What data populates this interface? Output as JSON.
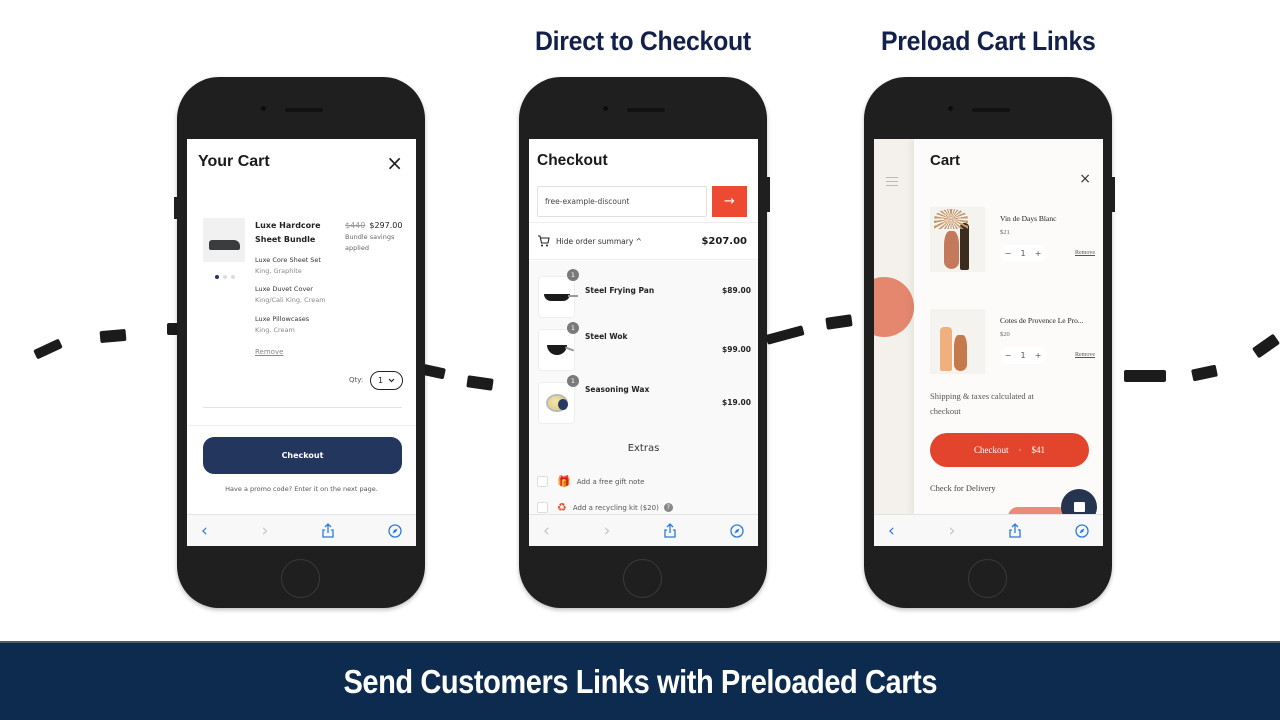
{
  "headings": {
    "direct_to_checkout": "Direct to Checkout",
    "preload_cart_links": "Preload Cart Links"
  },
  "banner": {
    "text": "Send Customers Links with  Preloaded Carts"
  },
  "colors": {
    "navy": "#13214a",
    "banner_bg": "#0d2a4f",
    "checkout_navy": "#23365d",
    "accent_red": "#ee4a31",
    "ios_blue": "#2a7ae2"
  },
  "phone1": {
    "title": "Your Cart",
    "close_icon": "×",
    "product": {
      "name": "Luxe Hardcore Sheet Bundle",
      "original_price": "$440",
      "price": "$297.00",
      "savings_note": "Bundle savings applied",
      "image_carousel": {
        "count": 3,
        "active": 1
      },
      "components": [
        {
          "name": "Luxe Core Sheet Set",
          "variant": "King, Graphite"
        },
        {
          "name": "Luxe Duvet Cover",
          "variant": "King/Cali King, Cream"
        },
        {
          "name": "Luxe Pillowcases",
          "variant": "King, Cream"
        }
      ],
      "remove_label": "Remove",
      "qty_label": "Qty:",
      "qty_value": "1"
    },
    "checkout_label": "Checkout",
    "promo_text": "Have a promo code? Enter it on the next page."
  },
  "phone2": {
    "title": "Checkout",
    "discount_value": "free-example-discount",
    "apply_icon": "→",
    "summary_toggle": "Hide order summary ^",
    "total": "$207.00",
    "items": [
      {
        "name": "Steel Frying Pan",
        "qty": "1",
        "price": "$89.00",
        "icon": "pan"
      },
      {
        "name": "Steel Wok",
        "qty": "1",
        "price": "$99.00",
        "icon": "wok"
      },
      {
        "name": "Seasoning Wax",
        "qty": "1",
        "price": "$19.00",
        "icon": "tin"
      }
    ],
    "extras_title": "Extras",
    "extras": [
      {
        "label": "Add a free gift note",
        "icon": "gift-icon",
        "glyph": "🎁"
      },
      {
        "label": "Add a recycling kit ($20)",
        "icon": "recycle-icon",
        "glyph": "♻"
      }
    ],
    "help_glyph": "?"
  },
  "phone3": {
    "title": "Cart",
    "close_icon": "×",
    "items": [
      {
        "name": "Vin de Days Blanc",
        "price": "$21",
        "qty": "1",
        "remove": "Remove"
      },
      {
        "name": "Cotes de Provence Le Pro...",
        "price": "$20",
        "qty": "1",
        "remove": "Remove"
      }
    ],
    "shipping_note": "Shipping & taxes calculated at checkout",
    "checkout_label": "Checkout",
    "checkout_sep": "·",
    "checkout_total": "$41",
    "delivery_label": "Check for Delivery"
  },
  "browser_nav": {
    "back": "‹",
    "forward": "›"
  }
}
